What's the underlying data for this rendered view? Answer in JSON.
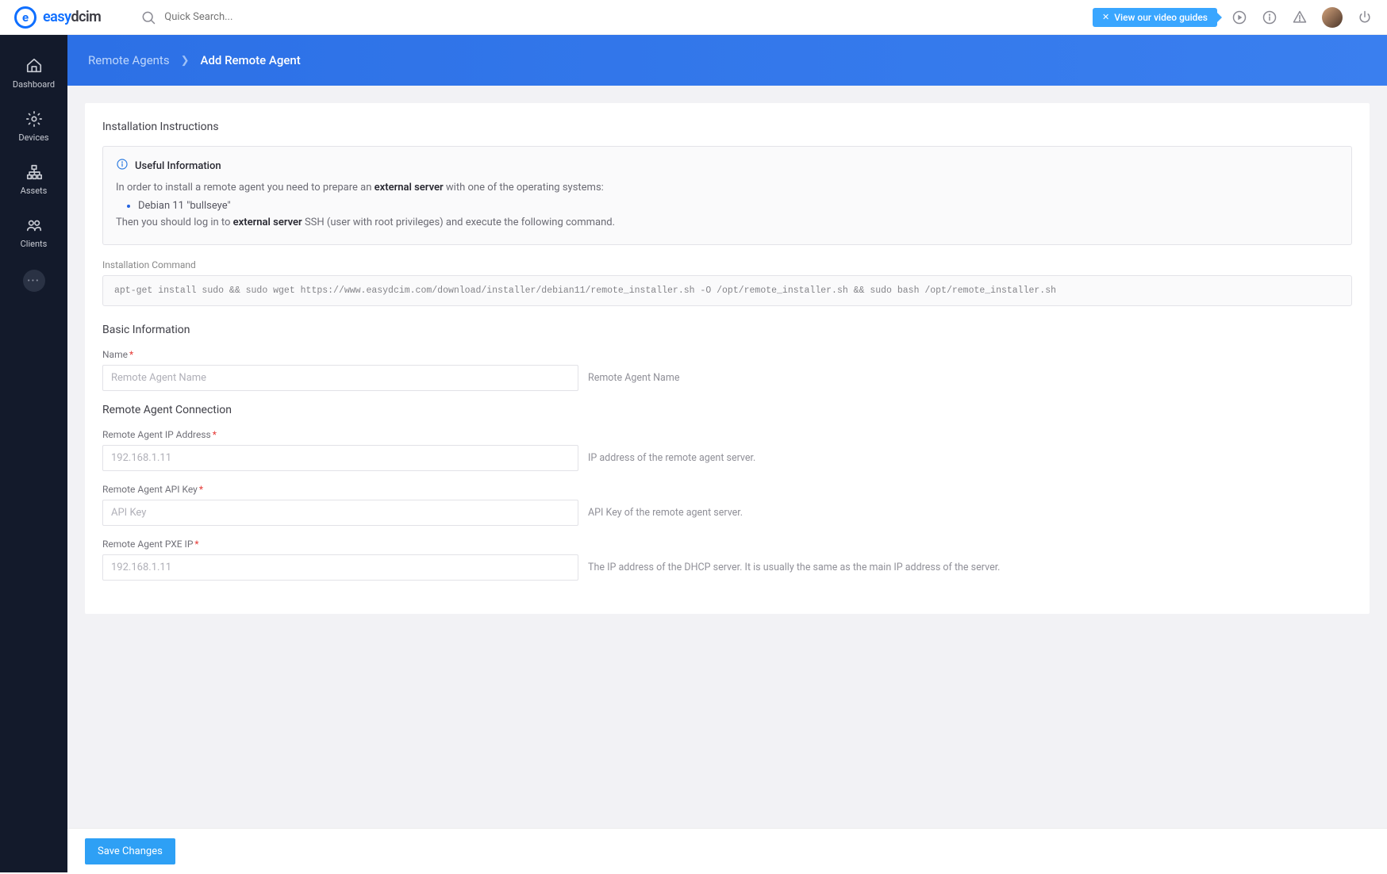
{
  "brand": {
    "name_blue": "easy",
    "name_dark": "dcim"
  },
  "search": {
    "placeholder": "Quick Search..."
  },
  "topbar": {
    "video_label": "View our video guides"
  },
  "sidebar": {
    "items": [
      {
        "label": "Dashboard"
      },
      {
        "label": "Devices"
      },
      {
        "label": "Assets"
      },
      {
        "label": "Clients"
      }
    ]
  },
  "breadcrumb": {
    "link": "Remote Agents",
    "active": "Add Remote Agent"
  },
  "sections": {
    "install_title": "Installation Instructions",
    "info_title": "Useful Information",
    "info_line1_a": "In order to install a remote agent you need to prepare an ",
    "info_line1_b": "external server",
    "info_line1_c": " with one of the operating systems:",
    "info_os": "Debian 11 \"bullseye\"",
    "info_line2_a": "Then you should log in to ",
    "info_line2_b": "external server",
    "info_line2_c": " SSH (user with root privileges) and execute the following command.",
    "cmd_label": "Installation Command",
    "cmd": "apt-get install sudo && sudo wget https://www.easydcim.com/download/installer/debian11/remote_installer.sh -O /opt/remote_installer.sh && sudo bash /opt/remote_installer.sh",
    "basic_title": "Basic Information",
    "conn_title": "Remote Agent Connection"
  },
  "fields": {
    "name": {
      "label": "Name",
      "placeholder": "Remote Agent Name",
      "help": "Remote Agent Name"
    },
    "ip": {
      "label": "Remote Agent IP Address",
      "placeholder": "192.168.1.11",
      "help": "IP address of the remote agent server."
    },
    "api": {
      "label": "Remote Agent API Key",
      "placeholder": "API Key",
      "help": "API Key of the remote agent server."
    },
    "pxe": {
      "label": "Remote Agent PXE IP",
      "placeholder": "192.168.1.11",
      "help": "The IP address of the DHCP server. It is usually the same as the main IP address of the server."
    }
  },
  "footer": {
    "save": "Save Changes"
  }
}
